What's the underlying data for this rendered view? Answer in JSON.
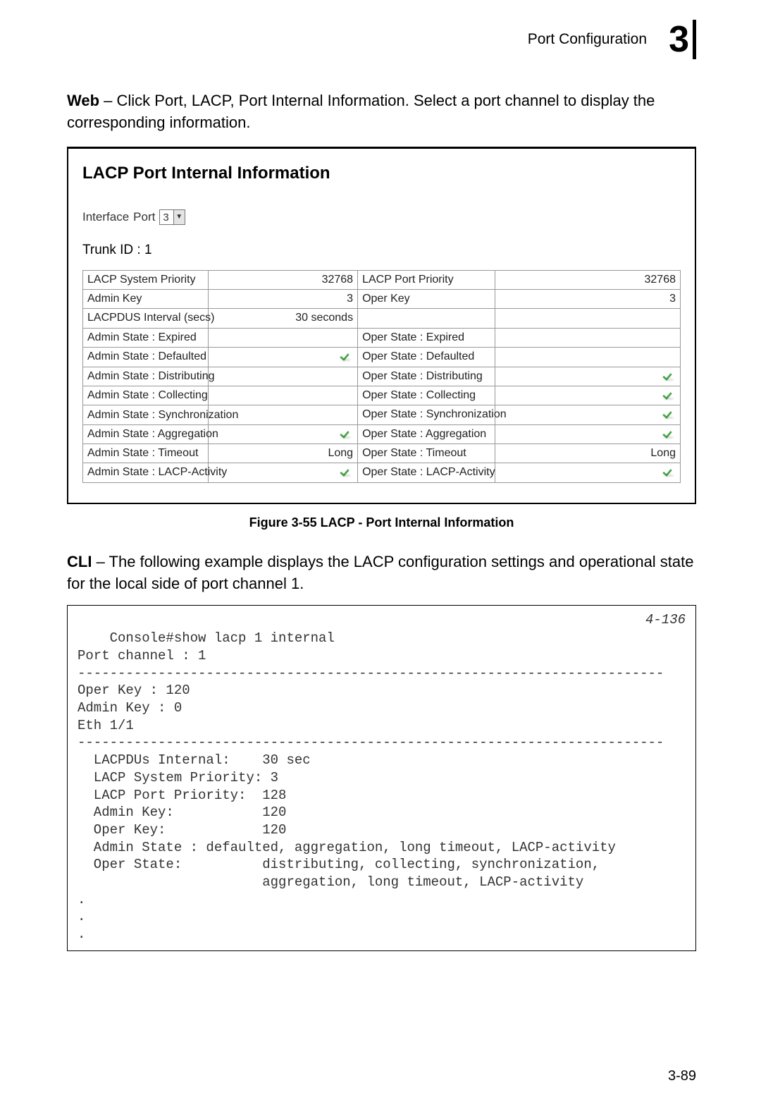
{
  "header": {
    "section_title": "Port Configuration",
    "chapter_number": "3"
  },
  "intro": {
    "label": "Web",
    "text": " – Click Port, LACP, Port Internal Information. Select a port channel to display the corresponding information."
  },
  "screenshot": {
    "title": "LACP Port Internal Information",
    "iface_label": "Interface",
    "iface_port_label": "Port",
    "iface_port_value": "3",
    "trunk_label": "Trunk ID : 1",
    "rows": {
      "r1": {
        "a": "LACP System Priority",
        "b": "32768",
        "c": "LACP Port Priority",
        "d": "32768"
      },
      "r2": {
        "a": "Admin Key",
        "b": "3",
        "c": "Oper Key",
        "d": "3"
      },
      "r3": {
        "a": "LACPDUS Interval (secs)",
        "b": "30 seconds",
        "c": "",
        "d": ""
      },
      "r4": {
        "a": "Admin State : Expired",
        "c": "Oper State : Expired"
      },
      "r5": {
        "a": "Admin State : Defaulted",
        "c": "Oper State : Defaulted"
      },
      "r6": {
        "a": "Admin State : Distributing",
        "c": "Oper State : Distributing"
      },
      "r7": {
        "a": "Admin State : Collecting",
        "c": "Oper State : Collecting"
      },
      "r8": {
        "a": "Admin State : Synchronization",
        "c": "Oper State : Synchronization"
      },
      "r9": {
        "a": "Admin State : Aggregation",
        "c": "Oper State : Aggregation"
      },
      "r10": {
        "a": "Admin State : Timeout",
        "b": "Long",
        "c": "Oper State : Timeout",
        "d": "Long"
      },
      "r11": {
        "a": "Admin State : LACP-Activity",
        "c": "Oper State : LACP-Activity"
      }
    }
  },
  "caption": "Figure 3-55  LACP - Port Internal Information",
  "cli_intro": {
    "label": "CLI",
    "text": " – The following example displays the LACP configuration settings and operational state for the local side of port channel 1."
  },
  "cli": {
    "ref": "4-136",
    "body": "Console#show lacp 1 internal\nPort channel : 1\n-------------------------------------------------------------------------\nOper Key : 120\nAdmin Key : 0\nEth 1/1\n-------------------------------------------------------------------------\n  LACPDUs Internal:    30 sec\n  LACP System Priority: 3\n  LACP Port Priority:  128\n  Admin Key:           120\n  Oper Key:            120\n  Admin State : defaulted, aggregation, long timeout, LACP-activity\n  Oper State:          distributing, collecting, synchronization,\n                       aggregation, long timeout, LACP-activity\n.\n.\n.\n"
  },
  "page_number": "3-89"
}
